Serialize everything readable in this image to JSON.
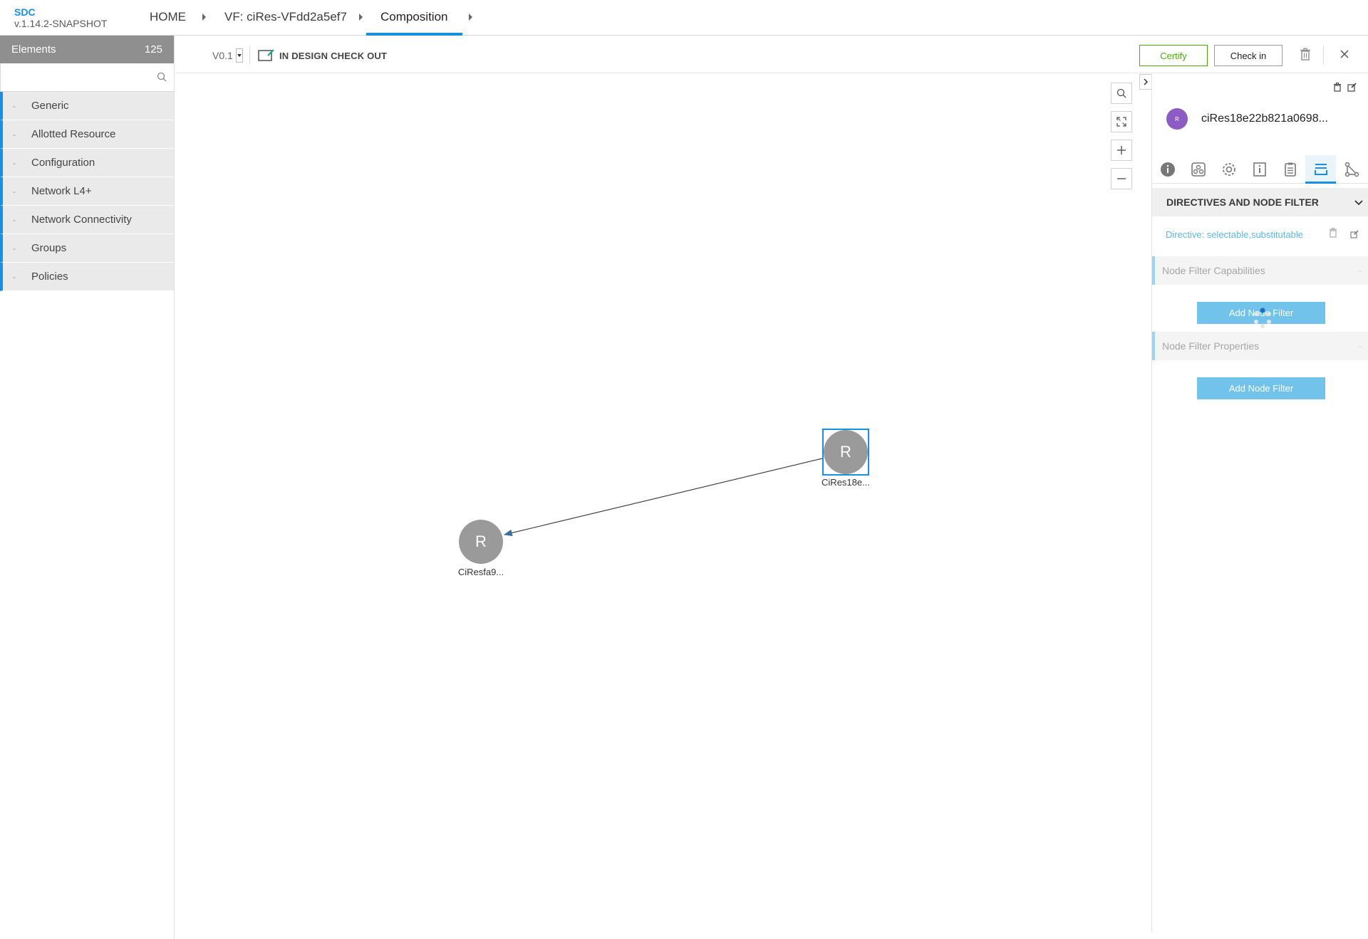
{
  "brand": {
    "name": "SDC",
    "version": "v.1.14.2-SNAPSHOT"
  },
  "breadcrumbs": [
    {
      "label": "HOME"
    },
    {
      "label": "VF: ciRes-VFdd2a5ef7"
    },
    {
      "label": "Composition"
    }
  ],
  "left_panel": {
    "title": "Elements",
    "count": "125",
    "search_placeholder": "",
    "categories": [
      {
        "label": "Generic"
      },
      {
        "label": "Allotted Resource"
      },
      {
        "label": "Configuration"
      },
      {
        "label": "Network L4+"
      },
      {
        "label": "Network Connectivity"
      },
      {
        "label": "Groups"
      },
      {
        "label": "Policies"
      }
    ],
    "collapse_marker": "-"
  },
  "toolbar": {
    "version": "V0.1",
    "status": "IN DESIGN CHECK OUT",
    "certify_label": "Certify",
    "checkin_label": "Check in"
  },
  "canvas": {
    "nodes": [
      {
        "letter": "R",
        "label": "CiRes18e...",
        "selected": true
      },
      {
        "letter": "R",
        "label": "CiResfa9...",
        "selected": false
      }
    ],
    "zoom_controls": [
      "search-icon",
      "fit-to-screen-icon",
      "zoom-in-icon",
      "zoom-out-icon"
    ]
  },
  "right_panel": {
    "avatar_letter": "R",
    "avatar_color": "#8e5bc4",
    "instance_name": "ciRes18e22b821a0698...",
    "tabs": [
      "info-icon",
      "deployment-artifacts-icon",
      "settings-icon",
      "information-icon",
      "requirements-icon",
      "directives-icon",
      "relations-icon"
    ],
    "active_tab": "directives-icon",
    "section_title": "DIRECTIVES AND NODE FILTER",
    "directive_text": "Directive: selectable,substitutable",
    "capabilities_title": "Node Filter Capabilities",
    "properties_title": "Node Filter Properties",
    "add_filter_label": "Add Node Filter",
    "collapse_marker": "-"
  },
  "colors": {
    "accent": "#1a8ee0",
    "certify": "#4ca90c",
    "node": "#9a9a9a",
    "button": "#72c3ec"
  }
}
